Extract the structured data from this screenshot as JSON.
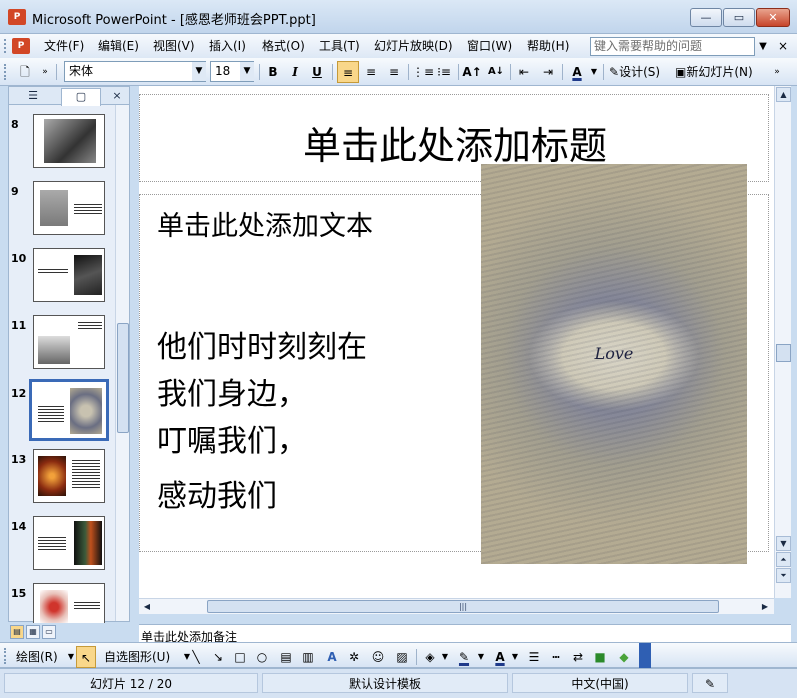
{
  "window": {
    "app_icon_text": "P",
    "title": "Microsoft PowerPoint - [感恩老师班会PPT.ppt]",
    "controls": {
      "minimize": "—",
      "maximize": "▭",
      "close": "✕"
    }
  },
  "menubar": {
    "items": [
      "文件(F)",
      "编辑(E)",
      "视图(V)",
      "插入(I)",
      "格式(O)",
      "工具(T)",
      "幻灯片放映(D)",
      "窗口(W)",
      "帮助(H)"
    ],
    "help_placeholder": "键入需要帮助的问题",
    "close_glyph": "×"
  },
  "toolbar": {
    "font_name": "宋体",
    "font_size": "18",
    "bold": "B",
    "italic": "I",
    "underline": "U",
    "design_label": "设计(S)",
    "new_slide_label": "新幻灯片(N)"
  },
  "panel": {
    "tabs": {
      "outline": "☰",
      "slides": "▢",
      "close": "×"
    },
    "slide_numbers": [
      "8",
      "9",
      "10",
      "11",
      "12",
      "13",
      "14",
      "15"
    ],
    "selected_slide": "12"
  },
  "slide": {
    "title_placeholder": "单击此处添加标题",
    "body_placeholder": "单击此处添加文本",
    "body_lines": [
      "他们时时刻刻在",
      "我们身边，",
      "叮嘱我们，",
      "感动我们"
    ],
    "image_text": "Love"
  },
  "notes": {
    "placeholder": "单击此处添加备注"
  },
  "drawbar": {
    "draw_label": "绘图(R)",
    "autoshapes_label": "自选图形(U)"
  },
  "statusbar": {
    "slide_position": "幻灯片 12 / 20",
    "design_template": "默认设计模板",
    "language": "中文(中国)"
  },
  "colors": {
    "accent": "#3a6ab7",
    "app_icon": "#d24726",
    "close_button": "#c7452a",
    "selected_tool": "#f9d78a"
  }
}
